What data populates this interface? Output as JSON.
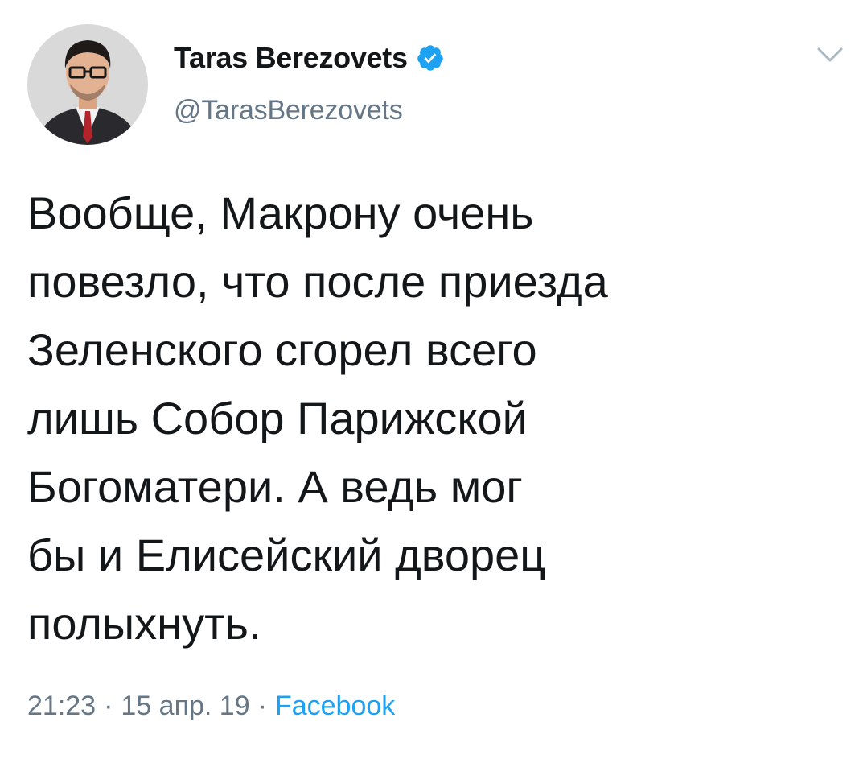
{
  "tweet": {
    "author": {
      "display_name": "Taras Berezovets",
      "handle": "@TarasBerezovets",
      "verified": true,
      "avatar_icon": "user-avatar"
    },
    "menu_icon": "chevron-down-icon",
    "text": "Вообще, Макрону очень\nповезло, что после приезда\nЗеленского сгорел всего\nлишь Собор Парижской\nБогоматери. А ведь мог\nбы и Елисейский дворец\nполыхнуть.",
    "time": "21:23",
    "separator": "·",
    "date": "15 апр. 19",
    "source": "Facebook"
  },
  "colors": {
    "text_primary": "#14171a",
    "text_secondary": "#657786",
    "accent": "#1da1f2",
    "verified_badge": "#1da1f2"
  }
}
